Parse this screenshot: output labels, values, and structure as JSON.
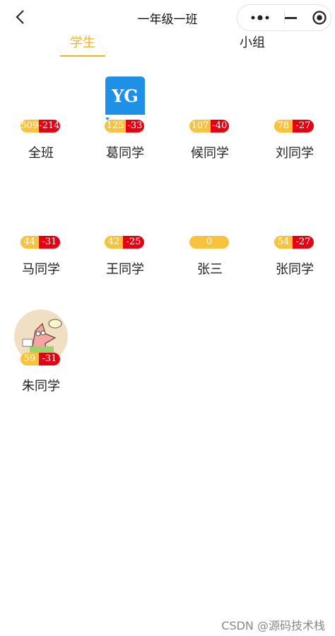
{
  "nav": {
    "title": "一年级一班",
    "back_icon": "chevron-left-icon",
    "more_icon": "more-dots-icon",
    "minimize_icon": "minus-icon",
    "close_icon": "target-circle-icon"
  },
  "tabs": [
    {
      "label": "学生",
      "active": true
    },
    {
      "label": "小组",
      "active": false
    }
  ],
  "colors": {
    "accent": "#f5b21a",
    "plus_badge": "#f9c23c",
    "minus_badge": "#e60012",
    "yg_avatar": "#1e90e6"
  },
  "students": [
    {
      "name": "全班",
      "plus": "509",
      "minus": "-214",
      "avatar": "none"
    },
    {
      "name": "葛同学",
      "plus": "125",
      "minus": "-33",
      "avatar": "YG"
    },
    {
      "name": "候同学",
      "plus": "107",
      "minus": "-40",
      "avatar": "none"
    },
    {
      "name": "刘同学",
      "plus": "78",
      "minus": "-27",
      "avatar": "none"
    },
    {
      "name": "马同学",
      "plus": "44",
      "minus": "-31",
      "avatar": "none"
    },
    {
      "name": "王同学",
      "plus": "42",
      "minus": "-25",
      "avatar": "none"
    },
    {
      "name": "张三",
      "plus": "0",
      "minus": "",
      "avatar": "none"
    },
    {
      "name": "张同学",
      "plus": "54",
      "minus": "-27",
      "avatar": "none"
    },
    {
      "name": "朱同学",
      "plus": "59",
      "minus": "-31",
      "avatar": "cartoon-starfish-image"
    }
  ],
  "watermark": "CSDN @源码技术栈"
}
